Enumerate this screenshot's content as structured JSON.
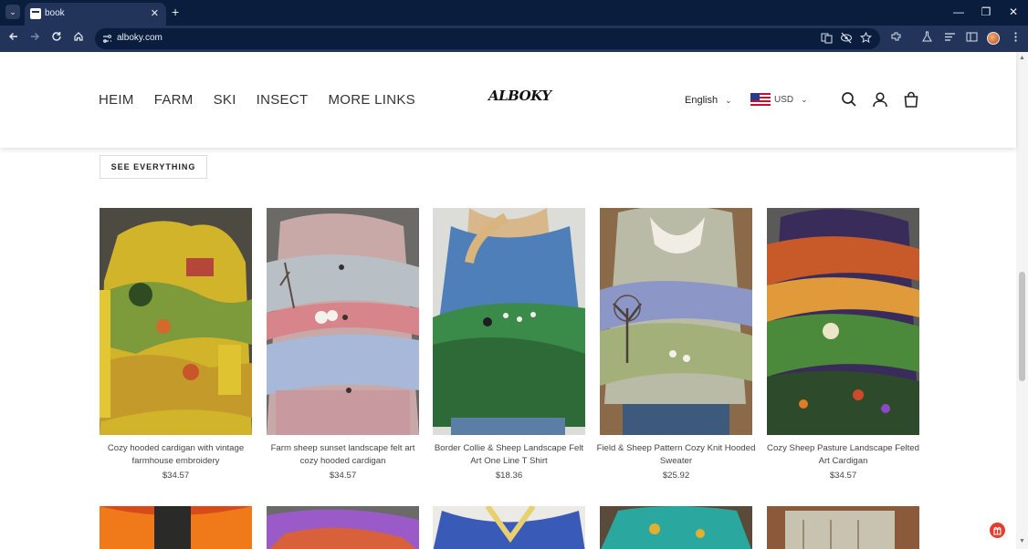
{
  "browser": {
    "tab_title": "book",
    "tab_close": "✕",
    "new_tab": "+",
    "url": "alboky.com",
    "window_controls": {
      "minimize": "—",
      "maximize": "❐",
      "close": "✕"
    }
  },
  "header": {
    "menu": [
      "HEIM",
      "FARM",
      "SKI",
      "INSECT",
      "MORE LINKS"
    ],
    "logo": "ALBOKY",
    "language": "English",
    "currency": "USD"
  },
  "section": {
    "see_all_label": "SEE EVERYTHING"
  },
  "products": [
    {
      "name": "Cozy hooded cardigan with vintage farmhouse embroidery",
      "price": "$34.57"
    },
    {
      "name": "Farm sheep sunset landscape felt art cozy hooded cardigan",
      "price": "$34.57"
    },
    {
      "name": "Border Collie & Sheep Landscape Felt Art One Line T Shirt",
      "price": "$18.36"
    },
    {
      "name": "Field & Sheep Pattern Cozy Knit Hooded Sweater",
      "price": "$25.92"
    },
    {
      "name": "Cozy Sheep Pasture Landscape Felted Art Cardigan",
      "price": "$34.57"
    }
  ],
  "icons": {
    "search": "search-icon",
    "account": "user-icon",
    "cart": "bag-icon"
  },
  "colors": {
    "chrome_dark": "#0b1d3d",
    "chrome_toolbar": "#22345a",
    "float_button": "#e23d2f"
  }
}
